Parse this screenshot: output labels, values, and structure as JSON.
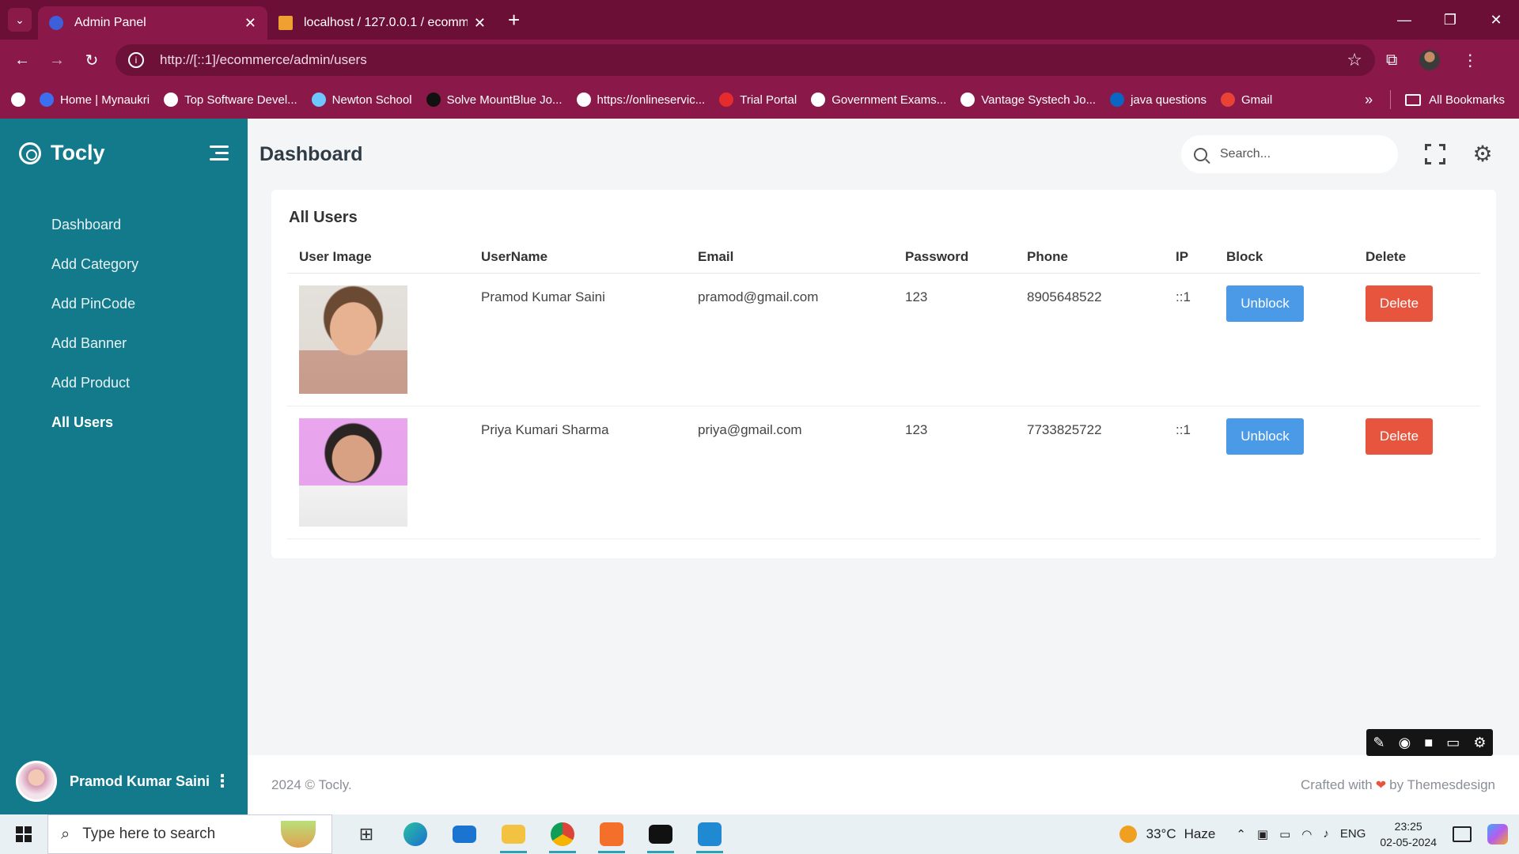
{
  "browser": {
    "tabs": [
      {
        "title": "Admin Panel",
        "active": true
      },
      {
        "title": "localhost / 127.0.0.1 / ecommerce",
        "active": false
      }
    ],
    "url": "http://[::1]/ecommerce/admin/users",
    "bookmarks": [
      {
        "label": "Home | Mynaukri",
        "color": "#3b6ff0"
      },
      {
        "label": "Top Software Devel...",
        "color": "#ffffff"
      },
      {
        "label": "Newton School",
        "color": "#6ec6ff"
      },
      {
        "label": "Solve MountBlue Jo...",
        "color": "#111111"
      },
      {
        "label": "https://onlineservic...",
        "color": "#ffffff"
      },
      {
        "label": "Trial Portal",
        "color": "#e52b2b"
      },
      {
        "label": "Government Exams...",
        "color": "#ffffff"
      },
      {
        "label": "Vantage Systech Jo...",
        "color": "#ffffff"
      },
      {
        "label": "java questions",
        "color": "#0a66c2"
      },
      {
        "label": "Gmail",
        "color": "#ea4335"
      }
    ],
    "all_bookmarks": "All Bookmarks"
  },
  "sidebar": {
    "brand": "Tocly",
    "items": [
      {
        "label": "Dashboard",
        "active": false
      },
      {
        "label": "Add Category",
        "active": false
      },
      {
        "label": "Add PinCode",
        "active": false
      },
      {
        "label": "Add Banner",
        "active": false
      },
      {
        "label": "Add Product",
        "active": false
      },
      {
        "label": "All Users",
        "active": true
      }
    ],
    "user_name": "Pramod Kumar Saini"
  },
  "header": {
    "title": "Dashboard",
    "search_placeholder": "Search..."
  },
  "users_card": {
    "title": "All Users",
    "columns": [
      "User Image",
      "UserName",
      "Email",
      "Password",
      "Phone",
      "IP",
      "Block",
      "Delete"
    ],
    "rows": [
      {
        "username": "Pramod Kumar Saini",
        "email": "pramod@gmail.com",
        "password": "123",
        "phone": "8905648522",
        "ip": "::1",
        "block_label": "Unblock",
        "delete_label": "Delete"
      },
      {
        "username": "Priya Kumari Sharma",
        "email": "priya@gmail.com",
        "password": "123",
        "phone": "7733825722",
        "ip": "::1",
        "block_label": "Unblock",
        "delete_label": "Delete"
      }
    ]
  },
  "footer": {
    "left": "2024 © Tocly.",
    "crafted": "Crafted with",
    "by": "by Themesdesign"
  },
  "taskbar": {
    "search_placeholder": "Type here to search",
    "temperature": "33°C",
    "weather": "Haze",
    "language": "ENG",
    "time": "23:25",
    "date": "02-05-2024"
  },
  "colors": {
    "sidebar": "#137a8b",
    "browser_frame": "#8a1848",
    "unblock": "#4a9ae8",
    "delete": "#e8553f"
  }
}
